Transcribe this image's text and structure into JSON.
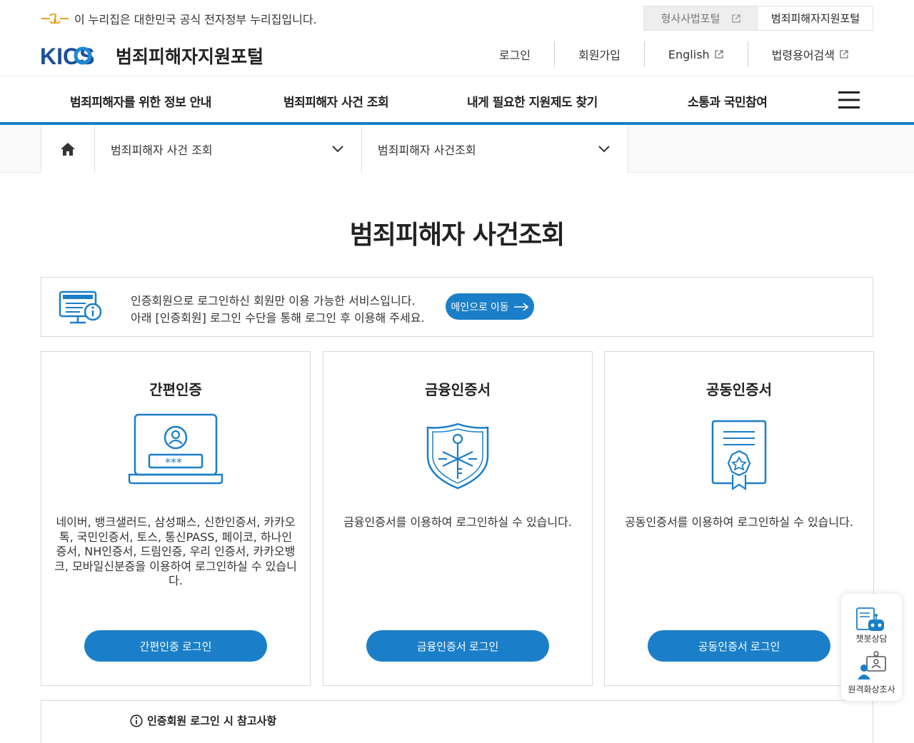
{
  "gov_banner": {
    "text": "이 누리집은 대한민국 공식 전자정부 누리집입니다."
  },
  "top_tabs": [
    {
      "label": "형사사법포털",
      "active": false
    },
    {
      "label": "범죄피해자지원포털",
      "active": true
    }
  ],
  "logo": {
    "brand": "KICS",
    "name": "범죄피해자지원포털"
  },
  "utility_nav": [
    {
      "label": "로그인",
      "external": false
    },
    {
      "label": "회원가입",
      "external": false
    },
    {
      "label": "English",
      "external": true
    },
    {
      "label": "법령용어검색",
      "external": true
    }
  ],
  "gnb": [
    {
      "label": "범죄피해자를 위한 정보 안내"
    },
    {
      "label": "범죄피해자 사건 조회"
    },
    {
      "label": "내게 필요한 지원제도 찾기"
    },
    {
      "label": "소통과 국민참여"
    }
  ],
  "breadcrumb": {
    "level1": "범죄피해자 사건 조회",
    "level2": "범죄피해자 사건조회"
  },
  "page_title": "범죄피해자 사건조회",
  "notice": {
    "line1": "인증회원으로 로그인하신 회원만 이용 가능한 서비스입니다.",
    "line2": "아래 [인증회원] 로그인 수단을 통해 로그인 후 이용해 주세요.",
    "button": "메인으로 이동"
  },
  "cards": [
    {
      "title": "간편인증",
      "icon": "laptop-login-icon",
      "desc": "네이버, 뱅크샐러드, 삼성패스, 신한인증서, 카카오톡, 국민인증서, 토스, 통신PASS, 페이코, 하나인증서, NH인증서, 드림인증, 우리 인증서, 카카오뱅크, 모바일신분증을 이용하여 로그인하실 수 있습니다.",
      "button": "간편인증 로그인",
      "mask": "***"
    },
    {
      "title": "금융인증서",
      "icon": "shield-key-icon",
      "desc": "금융인증서를 이용하여 로그인하실 수 있습니다.",
      "button": "금융인증서 로그인"
    },
    {
      "title": "공동인증서",
      "icon": "certificate-icon",
      "desc": "공동인증서를 이용하여 로그인하실 수 있습니다.",
      "button": "공동인증서 로그인"
    }
  ],
  "reference": {
    "title": "인증회원 로그인 시 참고사항"
  },
  "floating": {
    "chatbot": "챗봇상담",
    "remote": "원격화상조사"
  },
  "colors": {
    "primary": "#1a7fc8",
    "brand_dark": "#1b4d9a"
  }
}
